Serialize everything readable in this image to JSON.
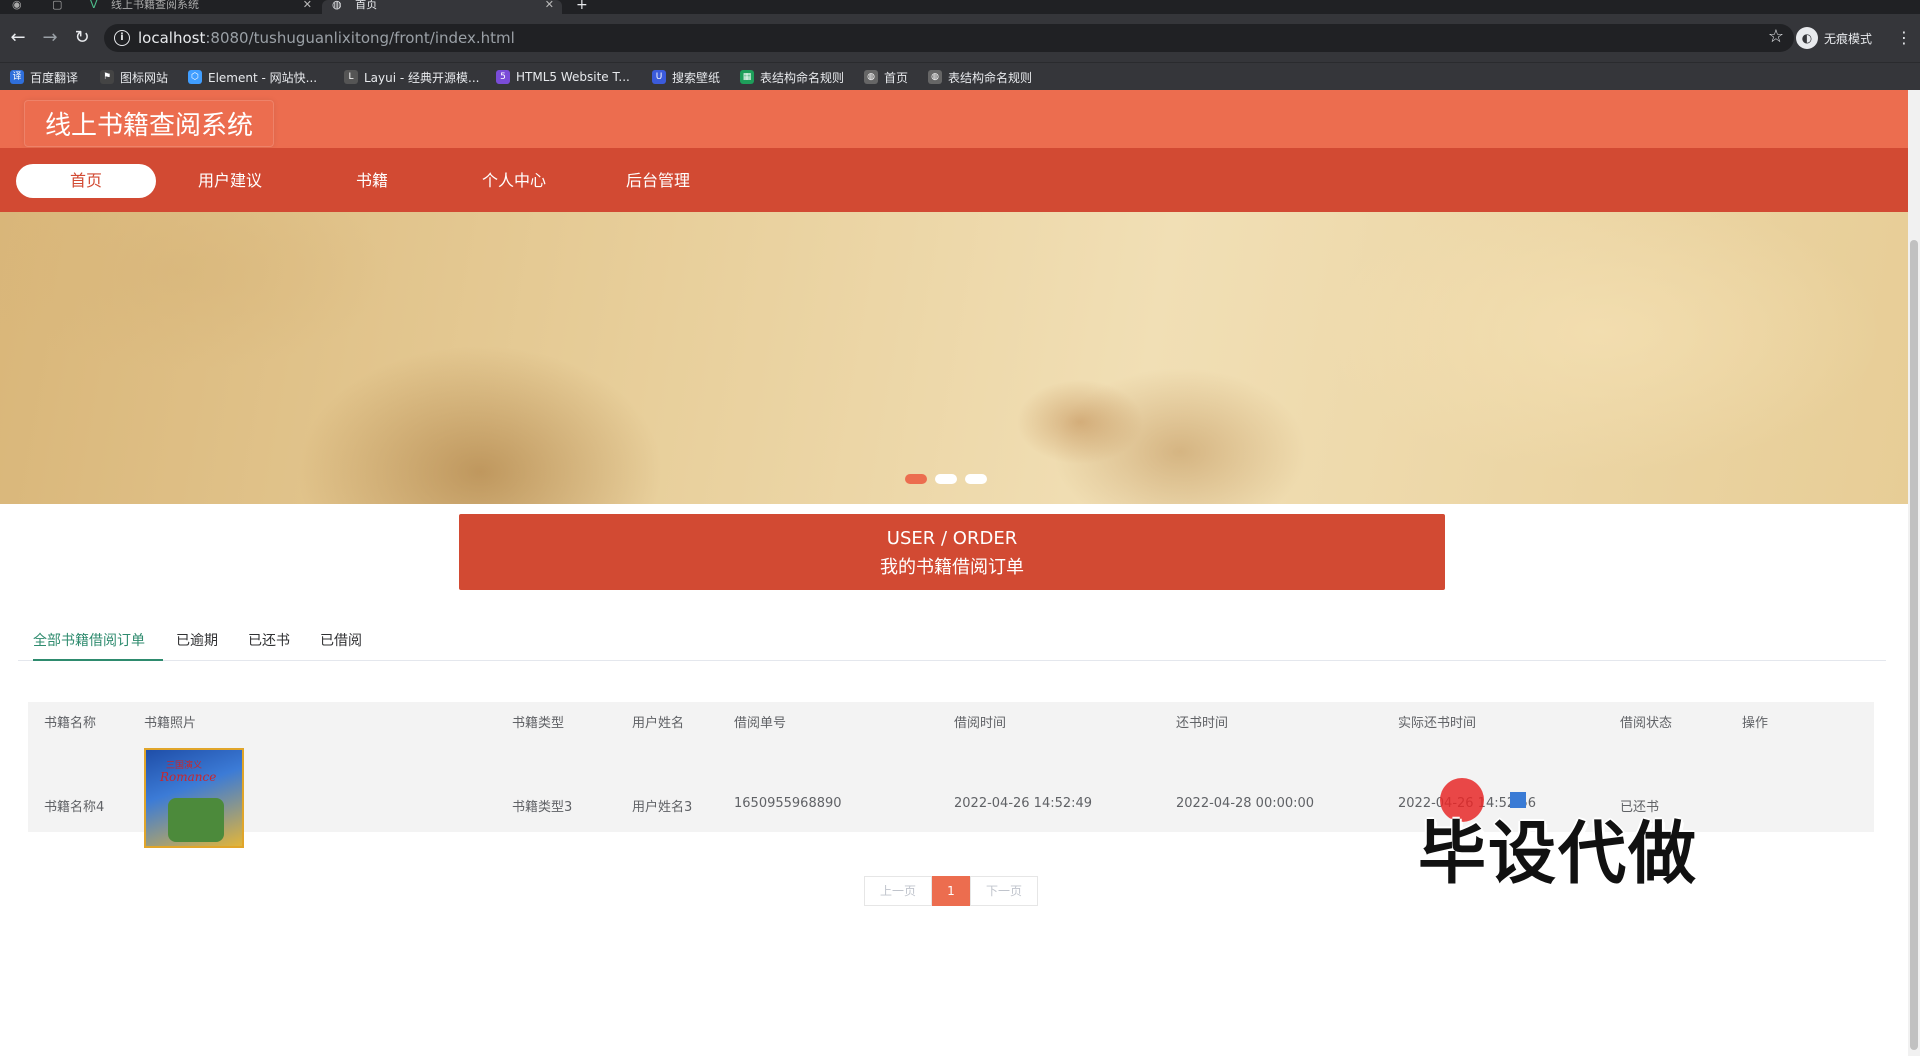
{
  "browser": {
    "tabs": [
      {
        "title": "线上书籍查阅系统",
        "active": false
      },
      {
        "title": "首页",
        "active": true
      }
    ],
    "new_tab": "+",
    "url_host": "localhost",
    "url_rest": ":8080/tushuguanlixitong/front/index.html",
    "profile_label": "无痕模式",
    "bookmarks": [
      {
        "label": "百度翻译",
        "icon": "translate-icon",
        "color": "#2f6fdb"
      },
      {
        "label": "图标网站",
        "icon": "flag-icon",
        "color": "#444"
      },
      {
        "label": "Element - 网站快...",
        "icon": "element-icon",
        "color": "#409eff"
      },
      {
        "label": "Layui - 经典开源模...",
        "icon": "layui-icon",
        "color": "#555"
      },
      {
        "label": "HTML5 Website T...",
        "icon": "html5-icon",
        "color": "#7a4cd8"
      },
      {
        "label": "搜索壁纸",
        "icon": "wallpaper-icon",
        "color": "#3b5bdb"
      },
      {
        "label": "表结构命名规则",
        "icon": "sheet-icon",
        "color": "#1e9e5a"
      },
      {
        "label": "首页",
        "icon": "globe-icon",
        "color": "#666"
      },
      {
        "label": "表结构命名规则",
        "icon": "globe-icon",
        "color": "#666"
      }
    ]
  },
  "site": {
    "title": "线上书籍查阅系统",
    "nav": [
      {
        "label": "首页",
        "active": true
      },
      {
        "label": "用户建议",
        "active": false
      },
      {
        "label": "书籍",
        "active": false
      },
      {
        "label": "个人中心",
        "active": false
      },
      {
        "label": "后台管理",
        "active": false
      }
    ],
    "colors": {
      "header": "#ec6d4f",
      "nav": "#d24a33",
      "accent": "#2e8b6e"
    }
  },
  "banner": {
    "slides": 3,
    "active_slide": 1
  },
  "section": {
    "en": "USER / ORDER",
    "zh": "我的书籍借阅订单"
  },
  "order_tabs": [
    {
      "label": "全部书籍借阅订单",
      "active": true
    },
    {
      "label": "已逾期",
      "active": false
    },
    {
      "label": "已还书",
      "active": false
    },
    {
      "label": "已借阅",
      "active": false
    }
  ],
  "table": {
    "headers": [
      "书籍名称",
      "书籍照片",
      "书籍类型",
      "用户姓名",
      "借阅单号",
      "借阅时间",
      "还书时间",
      "实际还书时间",
      "借阅状态",
      "操作"
    ],
    "rows": [
      {
        "name": "书籍名称4",
        "photo_title": "三国演义",
        "photo_subtitle": "Romance",
        "type": "书籍类型3",
        "user": "用户姓名3",
        "order_no": "1650955968890",
        "borrow_time": "2022-04-26 14:52:49",
        "return_time": "2022-04-28 00:00:00",
        "actual_return_time": "2022-04-26 14:52:56",
        "status": "已还书",
        "action": ""
      }
    ]
  },
  "pagination": {
    "prev": "上一页",
    "current": "1",
    "next": "下一页"
  },
  "watermark": "毕设代做"
}
